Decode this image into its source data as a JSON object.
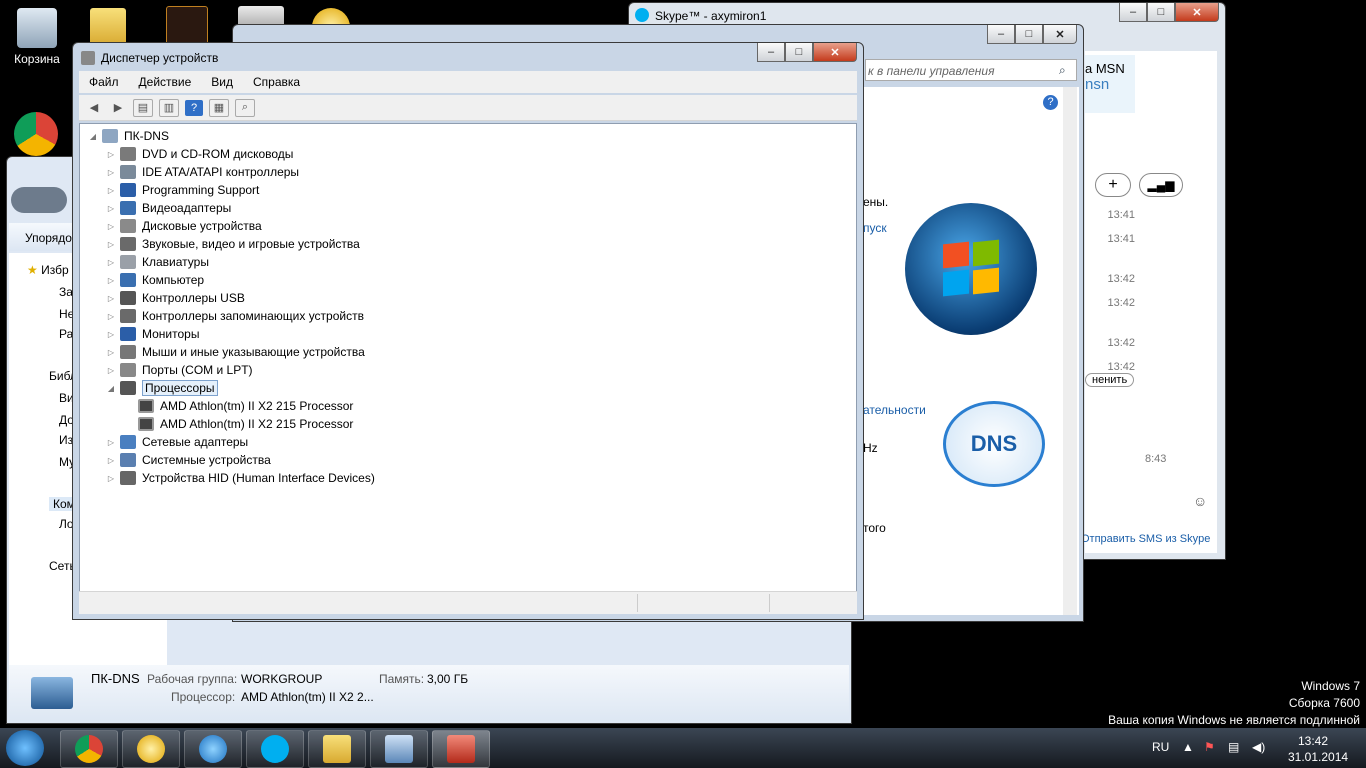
{
  "desktop": {
    "recycle_bin_label": "Корзина"
  },
  "skype": {
    "title": "Skype™ - axymiron1",
    "ad_text": "а MSN",
    "ad_text2": "nsn",
    "times": [
      "13:41",
      "13:41",
      "13:42",
      "13:42",
      "13:42",
      "13:42"
    ],
    "status_time": "8:43",
    "send_button": "ненить",
    "sms_link": "Отправить SMS из Skype"
  },
  "control_panel": {
    "search_placeholder": "к в панели управления",
    "text1": "ены.",
    "link1": "пуск",
    "link2": "ательности",
    "text2": "Hz",
    "text3": "того",
    "dns_logo": "DNS"
  },
  "device_manager": {
    "title": "Диспетчер устройств",
    "menu": [
      "Файл",
      "Действие",
      "Вид",
      "Справка"
    ],
    "root": "ПК-DNS",
    "categories": [
      "DVD и CD-ROM дисководы",
      "IDE ATA/ATAPI контроллеры",
      "Programming Support",
      "Видеоадаптеры",
      "Дисковые устройства",
      "Звуковые, видео и игровые устройства",
      "Клавиатуры",
      "Компьютер",
      "Контроллеры USB",
      "Контроллеры запоминающих устройств",
      "Мониторы",
      "Мыши и иные указывающие устройства",
      "Порты (COM и LPT)",
      "Процессоры",
      "Сетевые адаптеры",
      "Системные устройства",
      "Устройства HID (Human Interface Devices)"
    ],
    "processors": [
      "AMD Athlon(tm) II X2 215 Processor",
      "AMD Athlon(tm) II X2 215 Processor"
    ]
  },
  "explorer": {
    "organize": "Упорядо",
    "nav": [
      "Избр",
      "За",
      "Не",
      "Ра",
      "Библ",
      "Ви",
      "До",
      "Из",
      "Му",
      "Ком",
      "Ло",
      "Сеть"
    ],
    "computer_name": "ПК-DNS",
    "workgroup_label": "Рабочая группа:",
    "workgroup": "WORKGROUP",
    "memory_label": "Память:",
    "memory": "3,00 ГБ",
    "cpu_label": "Процессор:",
    "cpu": "AMD Athlon(tm) II X2 2..."
  },
  "watermark": {
    "line1": "Windows 7",
    "line2": "Сборка 7600",
    "line3": "Ваша копия Windows не является подлинной"
  },
  "taskbar": {
    "lang": "RU",
    "time": "13:42",
    "date": "31.01.2014"
  }
}
